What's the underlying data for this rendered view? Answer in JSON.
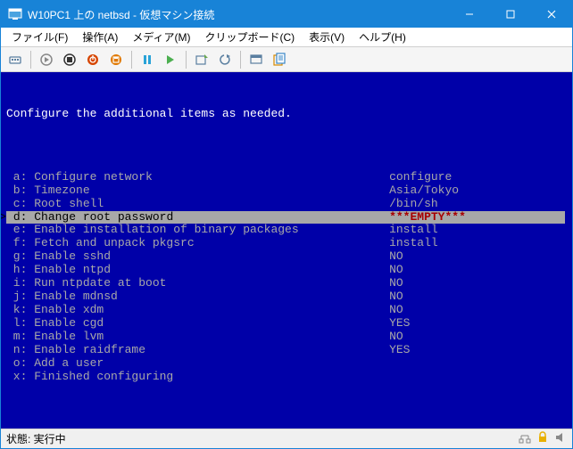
{
  "window": {
    "title": "W10PC1 上の netbsd - 仮想マシン接続"
  },
  "menubar": {
    "items": [
      "ファイル(F)",
      "操作(A)",
      "メディア(M)",
      "クリップボード(C)",
      "表示(V)",
      "ヘルプ(H)"
    ]
  },
  "terminal": {
    "header": "Configure the additional items as needed.",
    "rows": [
      {
        "key": "a",
        "label": "Configure network",
        "value": "configure",
        "hl": false
      },
      {
        "key": "b",
        "label": "Timezone",
        "value": "Asia/Tokyo",
        "hl": false
      },
      {
        "key": "c",
        "label": "Root shell",
        "value": "/bin/sh",
        "hl": false
      },
      {
        "key": "d",
        "label": "Change root password",
        "value": "***EMPTY***",
        "hl": true
      },
      {
        "key": "e",
        "label": "Enable installation of binary packages",
        "value": "install",
        "hl": false
      },
      {
        "key": "f",
        "label": "Fetch and unpack pkgsrc",
        "value": "install",
        "hl": false
      },
      {
        "key": "g",
        "label": "Enable sshd",
        "value": "NO",
        "hl": false
      },
      {
        "key": "h",
        "label": "Enable ntpd",
        "value": "NO",
        "hl": false
      },
      {
        "key": "i",
        "label": "Run ntpdate at boot",
        "value": "NO",
        "hl": false
      },
      {
        "key": "j",
        "label": "Enable mdnsd",
        "value": "NO",
        "hl": false
      },
      {
        "key": "k",
        "label": "Enable xdm",
        "value": "NO",
        "hl": false
      },
      {
        "key": "l",
        "label": "Enable cgd",
        "value": "YES",
        "hl": false
      },
      {
        "key": "m",
        "label": "Enable lvm",
        "value": "NO",
        "hl": false
      },
      {
        "key": "n",
        "label": "Enable raidframe",
        "value": "YES",
        "hl": false
      },
      {
        "key": "o",
        "label": "Add a user",
        "value": "",
        "hl": false
      },
      {
        "key": "x",
        "label": "Finished configuring",
        "value": "",
        "hl": false
      }
    ]
  },
  "statusbar": {
    "text": "状態: 実行中"
  }
}
